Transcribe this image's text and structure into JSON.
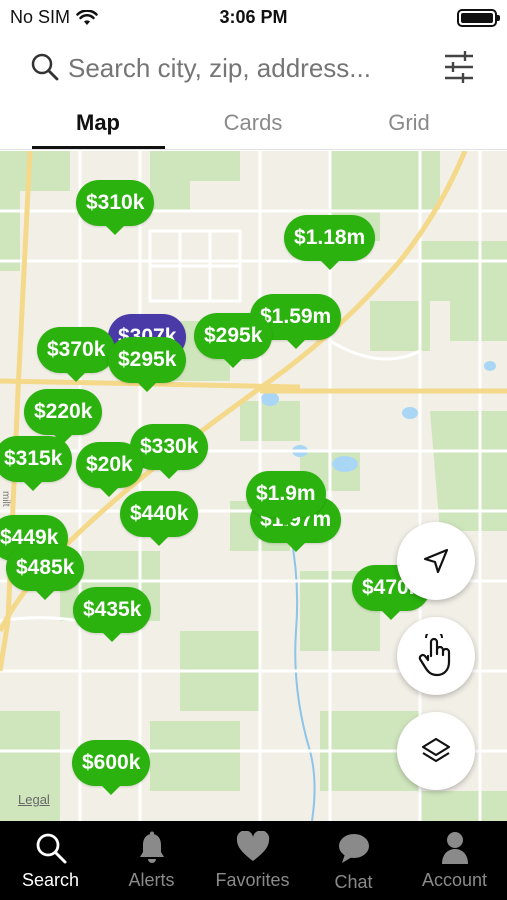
{
  "status_bar": {
    "carrier": "No SIM",
    "time": "3:06 PM"
  },
  "search": {
    "placeholder": "Search city, zip, address..."
  },
  "tabs": [
    {
      "label": "Map",
      "active": true
    },
    {
      "label": "Cards",
      "active": false
    },
    {
      "label": "Grid",
      "active": false
    }
  ],
  "map": {
    "legal": "Legal",
    "pins": [
      {
        "price": "$310k"
      },
      {
        "price": "$1.18m"
      },
      {
        "price": "$307k"
      },
      {
        "price": "$1.59m"
      },
      {
        "price": "$295k"
      },
      {
        "price": "$370k"
      },
      {
        "price": "$295k"
      },
      {
        "price": "$220k"
      },
      {
        "price": "$315k"
      },
      {
        "price": "$330k"
      },
      {
        "price": "$20k"
      },
      {
        "price": "$440k"
      },
      {
        "price": "$1.97m"
      },
      {
        "price": "$1.9m"
      },
      {
        "price": "$449k"
      },
      {
        "price": "$485k"
      },
      {
        "price": "$435k"
      },
      {
        "price": "$470k"
      },
      {
        "price": "$600k"
      }
    ]
  },
  "bottom_nav": [
    {
      "label": "Search",
      "icon": "search-icon",
      "active": true
    },
    {
      "label": "Alerts",
      "icon": "bell-icon",
      "active": false
    },
    {
      "label": "Favorites",
      "icon": "heart-icon",
      "active": false
    },
    {
      "label": "Chat",
      "icon": "chat-icon",
      "active": false
    },
    {
      "label": "Account",
      "icon": "person-icon",
      "active": false
    }
  ],
  "colors": {
    "pin": "#2bb20f",
    "pin_selected": "#4a3aa8",
    "nav_bg": "#000000"
  }
}
